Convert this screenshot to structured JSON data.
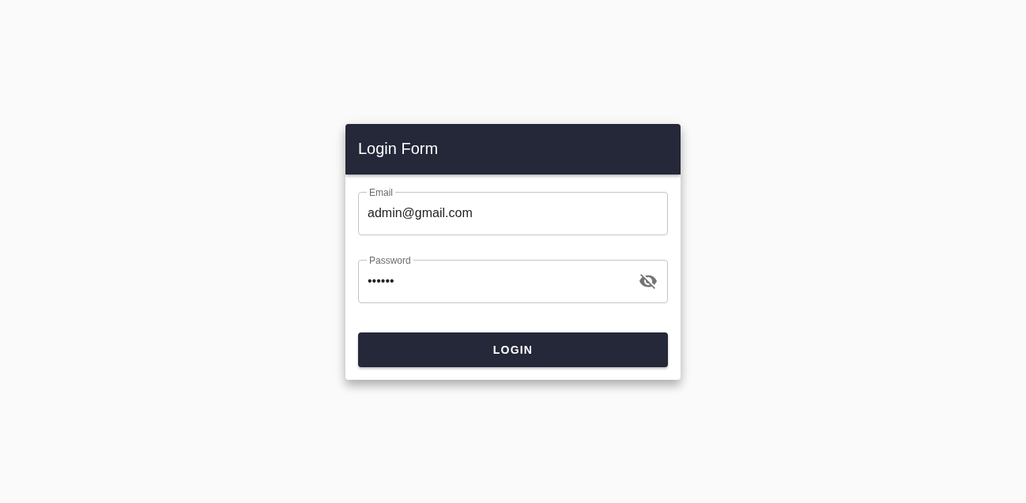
{
  "card": {
    "title": "Login Form"
  },
  "fields": [
    {
      "kind": "email",
      "label": "Email",
      "value": "admin@gmail.com"
    },
    {
      "kind": "password",
      "label": "Password",
      "value": "••••••",
      "revealed": false
    }
  ],
  "button": {
    "label": "LOGIN"
  }
}
